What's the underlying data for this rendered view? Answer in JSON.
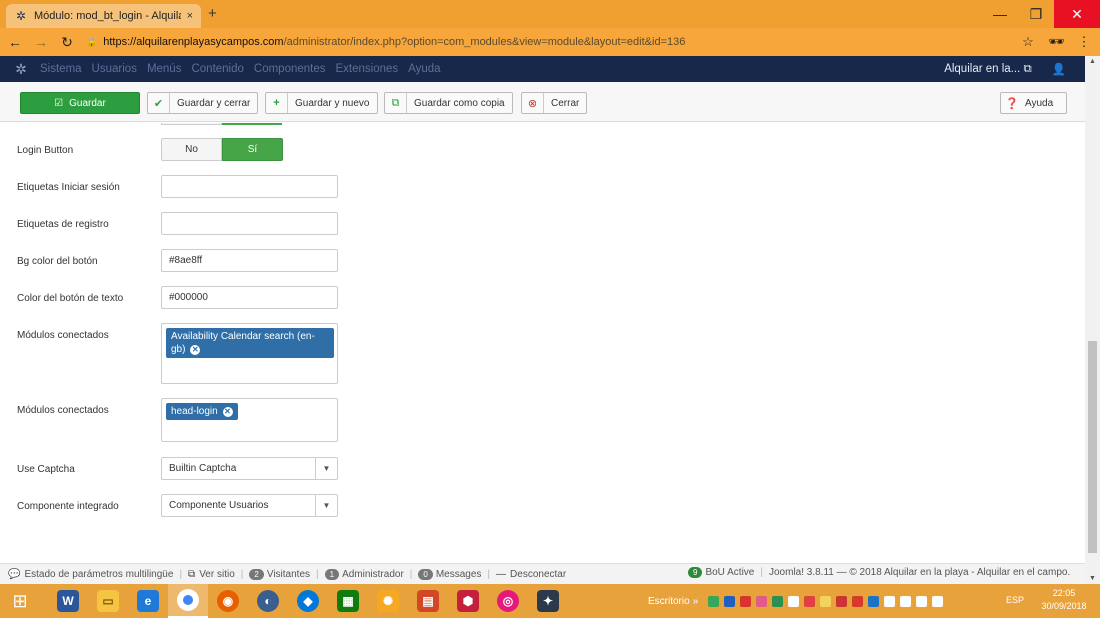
{
  "browser": {
    "tab_title": "Módulo: mod_bt_login - Alquilar",
    "tab_close": "×",
    "new_tab": "+",
    "url_host": "https://alquilarenplayasycampos.com",
    "url_path": "/administrator/index.php?option=com_modules&view=module&layout=edit&id=136",
    "win_min": "—",
    "win_max": "❐",
    "win_close": "✕"
  },
  "admin_nav": {
    "menu": [
      "Sistema",
      "Usuarios",
      "Menús",
      "Contenido",
      "Componentes",
      "Extensiones",
      "Ayuda"
    ],
    "site_link": "Alquilar en la... ⧉",
    "user": "👤"
  },
  "toolbar": {
    "save": "Guardar",
    "save_close": "Guardar y cerrar",
    "save_new": "Guardar y nuevo",
    "save_copy": "Guardar como copia",
    "close": "Cerrar",
    "help": "Ayuda"
  },
  "form": {
    "login_button": {
      "label": "Login Button",
      "no": "No",
      "yes": "Sí",
      "value": "Sí"
    },
    "login_labels": {
      "label": "Etiquetas Iniciar sesión",
      "value": ""
    },
    "register_labels": {
      "label": "Etiquetas de registro",
      "value": ""
    },
    "bg_color": {
      "label": "Bg color del botón",
      "value": "#8ae8ff"
    },
    "text_color": {
      "label": "Color del botón de texto",
      "value": "#000000"
    },
    "modules_1": {
      "label": "Módulos conectados",
      "chips": [
        "Availability Calendar search (en-gb)"
      ]
    },
    "modules_2": {
      "label": "Módulos conectados",
      "chips": [
        "head-login"
      ]
    },
    "captcha": {
      "label": "Use Captcha",
      "value": "Builtin Captcha"
    },
    "component": {
      "label": "Componente integrado",
      "value": "Componente Usuarios"
    }
  },
  "status_bar": {
    "multilang": "Estado de parámetros multilingüe",
    "view_site": "Ver sitio",
    "visitors_count": "2",
    "visitors": "Visitantes",
    "admin_count": "1",
    "admin": "Administrador",
    "messages_count": "0",
    "messages": "Messages",
    "logout": "Desconectar",
    "bou_count": "9",
    "bou": "BoU Active",
    "footer": "Joomla! 3.8.11 — © 2018 Alquilar en la playa - Alquilar en el campo."
  },
  "taskbar": {
    "desktop_label": "Escritorio",
    "lang": "ESP",
    "time": "22:05",
    "date": "30/09/2018"
  },
  "colors": {
    "save_green": "#2d9e3f",
    "toggle_green": "#46a546",
    "chip_blue": "#2f6ea6",
    "admin_navy": "#17284a",
    "chrome_orange": "#f0a030"
  }
}
